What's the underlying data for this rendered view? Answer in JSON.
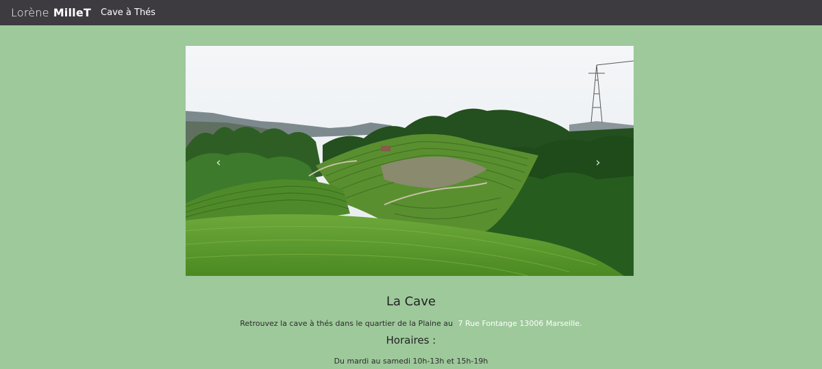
{
  "header": {
    "brand_first": "Lorène",
    "brand_last": "MilleT",
    "nav_link": "Cave à Thés"
  },
  "carousel": {
    "prev_icon": "chevron-left",
    "next_icon": "chevron-right"
  },
  "main": {
    "title": "La Cave",
    "description": "Retrouvez la cave à thés dans le quartier de la Plaine au",
    "address_link": "7 Rue Fontange 13006 Marseille.",
    "hours_title": "Horaires :",
    "hours_text": "Du mardi au samedi 10h-13h et 15h-19h"
  },
  "colors": {
    "header_bg": "#3d3b40",
    "page_bg": "#9ec99b",
    "link": "#ffffff"
  }
}
